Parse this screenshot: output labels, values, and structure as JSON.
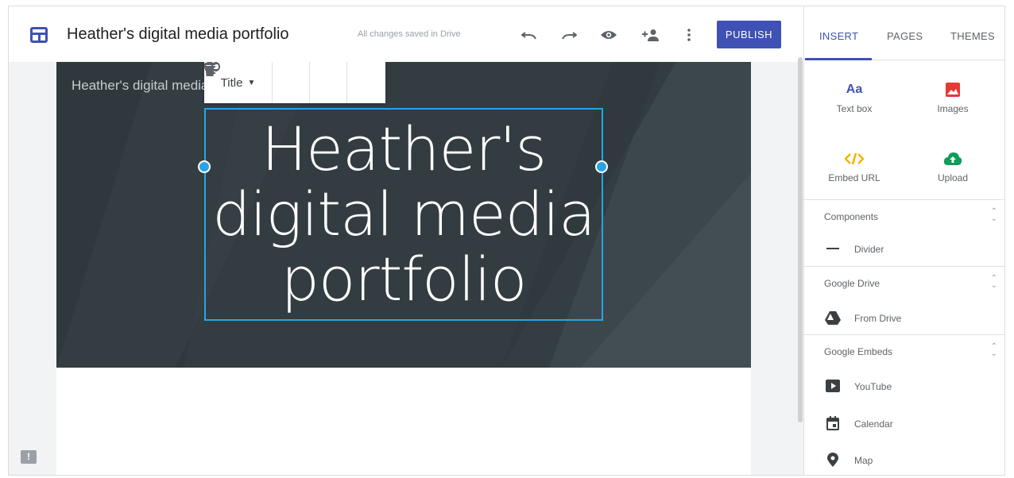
{
  "header": {
    "title": "Heather's digital media portfolio",
    "save_status": "All changes saved in Drive",
    "publish_label": "PUBLISH"
  },
  "editor": {
    "site_name": "Heather's digital media portfolio",
    "title_text": "Heather's digital media portfolio",
    "text_style": "Title"
  },
  "sidebar": {
    "tabs": [
      "INSERT",
      "PAGES",
      "THEMES"
    ],
    "active_tab": "INSERT",
    "insert_items": [
      {
        "label": "Text box",
        "icon": "text-box-icon"
      },
      {
        "label": "Images",
        "icon": "image-icon"
      },
      {
        "label": "Embed URL",
        "icon": "embed-icon"
      },
      {
        "label": "Upload",
        "icon": "upload-icon"
      }
    ],
    "sections": [
      {
        "title": "Components",
        "items": [
          {
            "label": "Divider",
            "icon": "divider-icon"
          }
        ]
      },
      {
        "title": "Google Drive",
        "items": [
          {
            "label": "From Drive",
            "icon": "drive-icon"
          }
        ]
      },
      {
        "title": "Google Embeds",
        "items": [
          {
            "label": "YouTube",
            "icon": "youtube-icon"
          },
          {
            "label": "Calendar",
            "icon": "calendar-icon"
          },
          {
            "label": "Map",
            "icon": "map-icon"
          }
        ]
      }
    ],
    "icon_text": "Aa"
  },
  "colors": {
    "accent": "#3f51b5",
    "selection": "#29a3e6",
    "banner": "#333c41"
  }
}
